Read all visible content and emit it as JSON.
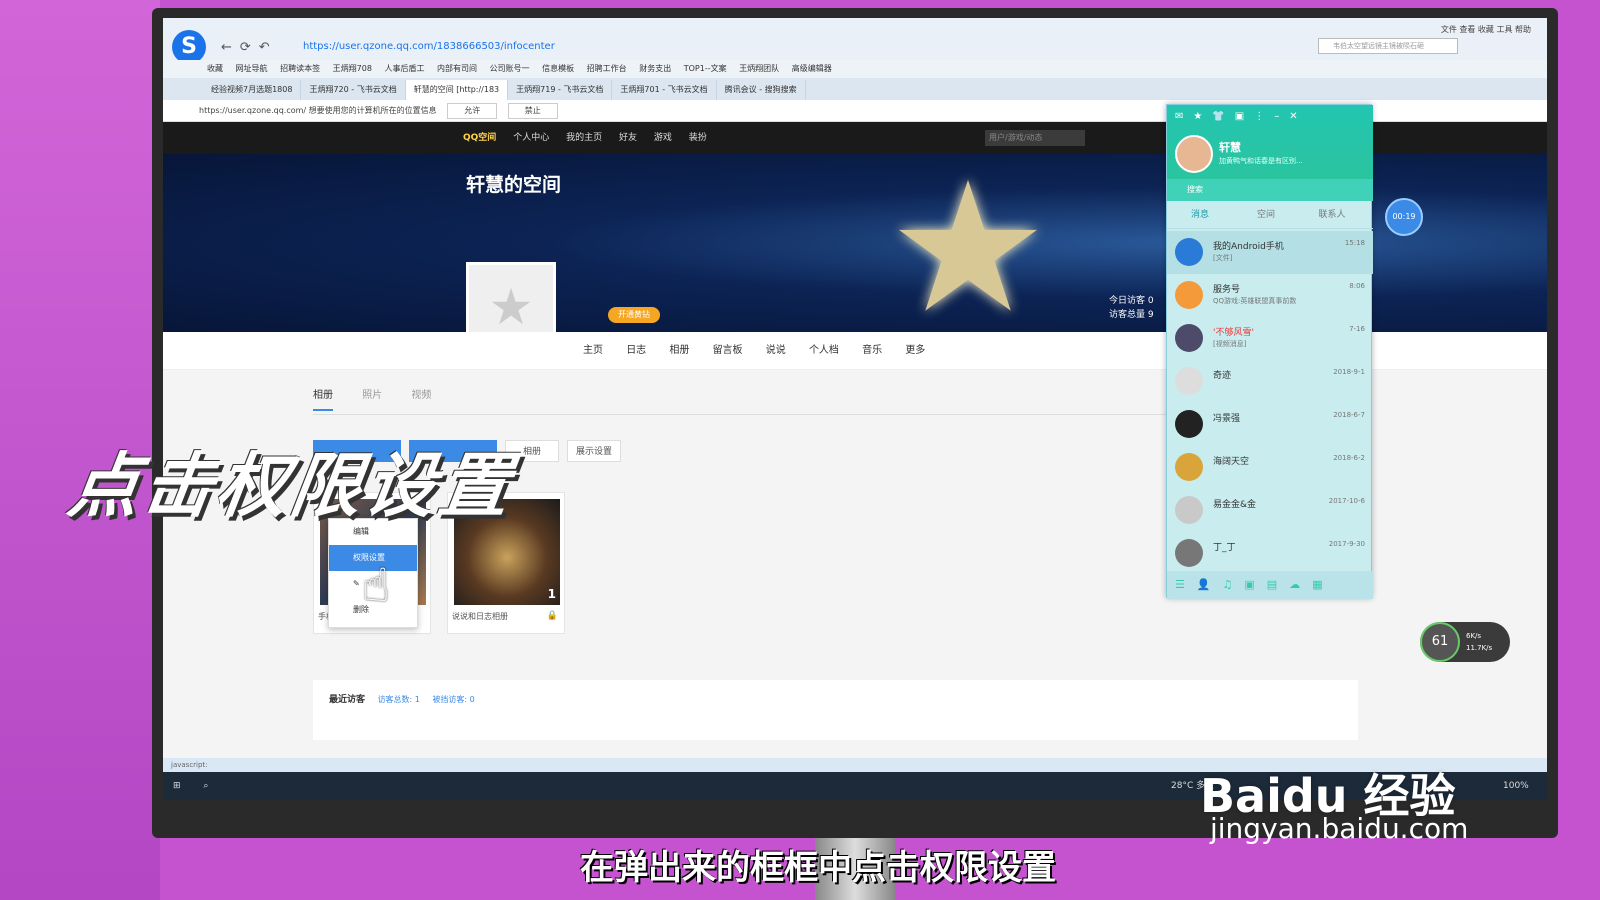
{
  "browser": {
    "url": "https://user.qzone.qq.com/1838666503/infocenter",
    "menu": "文件 查看 收藏 工具 帮助",
    "search_placeholder": "韦伯太空望远镜主镜被陨石砸"
  },
  "bookmarks": [
    "收藏",
    "网址导航",
    "招聘读本签",
    "王炳翔708",
    "人事后盾工",
    "内部有司间",
    "公司账号一",
    "信息模板",
    "招聘工作台",
    "财务支出",
    "TOP1--文案",
    "王炳翔团队",
    "高级编辑器"
  ],
  "tabs": [
    "经验视频7月选题1808",
    "王炳翔720 - 飞书云文档",
    "轩慧的空间 [http://183",
    "王炳翔719 - 飞书云文档",
    "王炳翔701 - 飞书云文档",
    "腾讯会议 - 搜狗搜索"
  ],
  "permission": {
    "text": "https://user.qzone.qq.com/ 想要使用您的计算机所在的位置信息",
    "allow": "允许",
    "deny": "禁止"
  },
  "qznav": {
    "brand": "QQ空间",
    "items": [
      "个人中心",
      "我的主页",
      "好友",
      "游戏",
      "装扮"
    ],
    "search_placeholder": "用户/游戏/动态"
  },
  "banner": {
    "title": "轩慧的空间",
    "vip": "开通黄钻",
    "today_visits": "今日访客 0",
    "total_visits": "访客总量 9"
  },
  "subnav": [
    "主页",
    "日志",
    "相册",
    "留言板",
    "说说",
    "个人档",
    "音乐",
    "更多"
  ],
  "album_tabs": [
    "相册",
    "照片",
    "视频"
  ],
  "actions": {
    "display_settings": "展示设置",
    "album": "相册"
  },
  "cards": [
    {
      "caption": "手机相册"
    },
    {
      "caption": "说说和日志相册",
      "count": "1"
    }
  ],
  "context_menu": [
    "编辑",
    "权限设置",
    "",
    "删除"
  ],
  "visitors": {
    "title": "最近访客",
    "total": "访客总数: 1",
    "blocked": "被挡访客: 0"
  },
  "statusbar": "javascript:",
  "taskbar": {
    "weather": "28°C 多云",
    "zoom": "100%"
  },
  "qq": {
    "name": "轩慧",
    "signature": "加黄鸭气和话春是有区别...",
    "search": "搜索",
    "tabs": [
      "消息",
      "空间",
      "联系人"
    ],
    "contacts": [
      {
        "name": "我的Android手机",
        "sub": "[文件]",
        "time": "15:18"
      },
      {
        "name": "服务号",
        "sub": "QQ游戏:英雄联盟真事前数",
        "time": "8:06"
      },
      {
        "name": "'不够风雪'",
        "sub": "[视频消息]",
        "time": "7-16"
      },
      {
        "name": "奇迹",
        "sub": "",
        "time": "2018-9-1"
      },
      {
        "name": "冯景强",
        "sub": "",
        "time": "2018-6-7"
      },
      {
        "name": "海阔天空",
        "sub": "",
        "time": "2018-6-2"
      },
      {
        "name": "易金金&金",
        "sub": "",
        "time": "2017-10-6"
      },
      {
        "name": "丁_丁",
        "sub": "",
        "time": "2017-9-30"
      }
    ]
  },
  "timer": "00:19",
  "speed": {
    "pct": "61",
    "up": "6K/s",
    "down": "11.7K/s"
  },
  "overlay": "点击权限设置",
  "subtitle": "在弹出来的框框中点击权限设置",
  "watermark": {
    "brand": "Baidu 经验",
    "url": "jingyan.baidu.com"
  },
  "colors": {
    "accent": "#3b8ae6",
    "qq_header": "#23c5b1"
  }
}
